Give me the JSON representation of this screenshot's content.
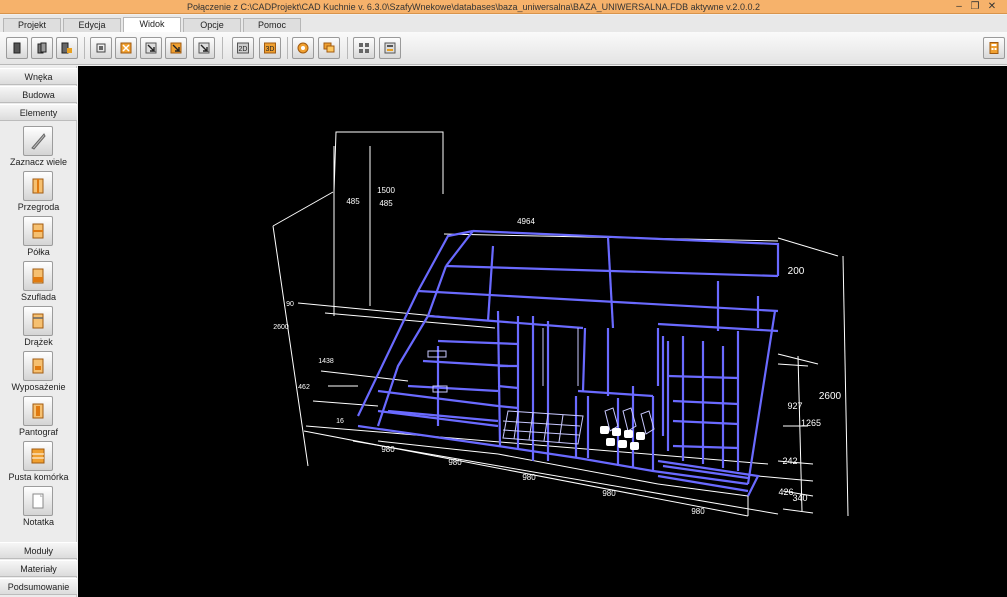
{
  "window": {
    "title": "Połączenie z C:\\CADProjekt\\CAD Kuchnie v. 6.3.0\\SzafyWnekowe\\databases\\baza_uniwersalna\\BAZA_UNIWERSALNA.FDB aktywne  v.2.0.0.2",
    "minimize": "–",
    "restore": "❐",
    "close": "✕"
  },
  "tabs": [
    "Projekt",
    "Edycja",
    "Widok",
    "Opcje",
    "Pomoc"
  ],
  "active_tab": "Widok",
  "sidebar": {
    "sections_top": [
      "Wnęka",
      "Budowa",
      "Elementy"
    ],
    "tools": [
      "Zaznacz wiele",
      "Przegroda",
      "Półka",
      "Szuflada",
      "Drążek",
      "Wyposażenie",
      "Pantograf",
      "Pusta komórka",
      "Notatka"
    ],
    "sections_bottom": [
      "Moduły",
      "Materiały",
      "Podsumowanie"
    ]
  },
  "drawing": {
    "dims": {
      "d1500": "1500",
      "d485a": "485",
      "d485b": "485",
      "d4964": "4964",
      "d200": "200",
      "d2600l": "2600",
      "d90": "90",
      "d1438": "1438",
      "d462": "462",
      "d16": "16",
      "d2600r": "2600",
      "d927": "927",
      "d1265": "1265",
      "d242": "242",
      "d426": "426",
      "d340": "340",
      "d980a": "980",
      "d980b": "980",
      "d980c": "980",
      "d980d": "980",
      "d980e": "980"
    }
  },
  "colors": {
    "titlebar": "#f6b26b",
    "frame": "#6a6aff",
    "dimension": "#ffffff",
    "canvas": "#000000"
  }
}
